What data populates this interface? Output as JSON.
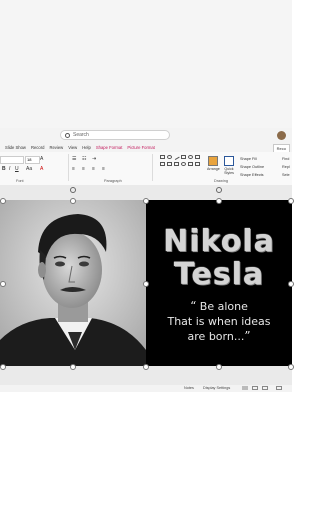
{
  "search": {
    "placeholder": "Search"
  },
  "tabs": [
    "Slide Show",
    "Record",
    "Review",
    "View",
    "Help",
    "Shape Format",
    "Picture Format"
  ],
  "record_button": "Reco",
  "font": {
    "size": "18"
  },
  "groups": {
    "font": "Font",
    "paragraph": "Paragraph",
    "drawing": "Drawing"
  },
  "drawing": {
    "arrange": "Arrange",
    "quick_styles": "Quick Styles",
    "shape_fill": "Shape Fill",
    "shape_outline": "Shape Outline",
    "shape_effects": "Shape Effects"
  },
  "right_options": [
    "Find",
    "Repl",
    "Sele"
  ],
  "slide": {
    "name_line1": "Nikola",
    "name_line2": "Tesla",
    "quote_line1": "Be alone",
    "quote_line2": "That is when ideas",
    "quote_line3": "are born...",
    "open_quote": "“",
    "close_quote": "”"
  },
  "status": {
    "notes": "Notes",
    "display_settings": "Display Settings"
  },
  "colors": {
    "panel": "#000000",
    "text": "#d4d4d4",
    "context_tab": "#c2185b"
  }
}
